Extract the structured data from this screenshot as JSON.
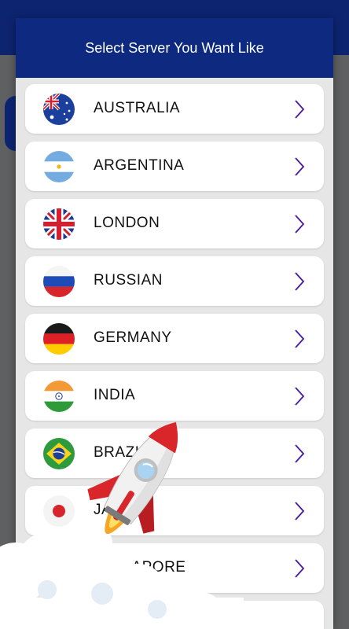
{
  "dialog": {
    "title": "Select Server You Want Like"
  },
  "servers": [
    {
      "name": "AUSTRALIA",
      "flag": "australia-flag-icon"
    },
    {
      "name": "ARGENTINA",
      "flag": "argentina-flag-icon"
    },
    {
      "name": "LONDON",
      "flag": "uk-flag-icon"
    },
    {
      "name": "RUSSIAN",
      "flag": "russia-flag-icon"
    },
    {
      "name": "GERMANY",
      "flag": "germany-flag-icon"
    },
    {
      "name": "INDIA",
      "flag": "india-flag-icon"
    },
    {
      "name": "BRAZIL",
      "flag": "brazil-flag-icon"
    },
    {
      "name": "JAPAN",
      "flag": "japan-flag-icon"
    },
    {
      "name": "SINGAPORE",
      "flag": "singapore-flag-icon"
    }
  ],
  "colors": {
    "header": "#0d2a80",
    "chevron": "#4a1a9c",
    "rocket": "#d8262b"
  },
  "icons": {
    "row_arrow": "chevron-right-icon",
    "overlay": "rocket-icon"
  }
}
